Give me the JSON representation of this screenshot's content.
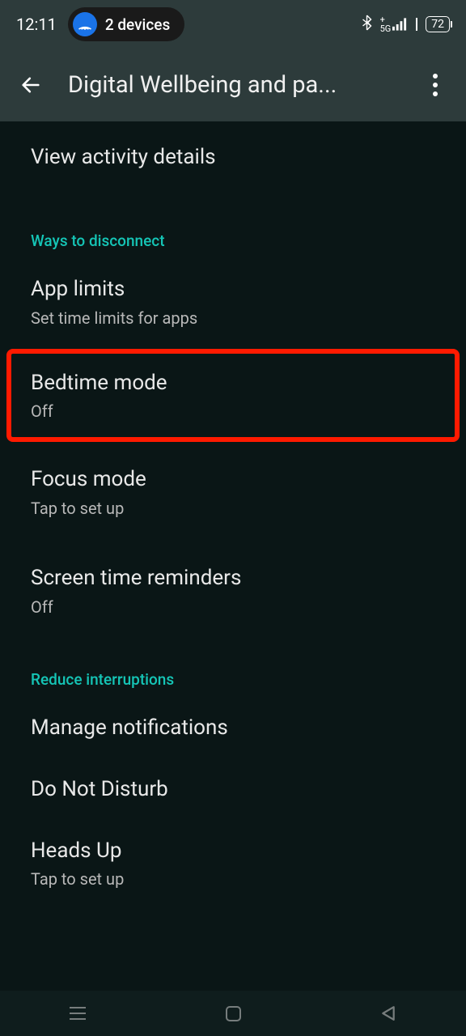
{
  "statusbar": {
    "time": "12:11",
    "devices_label": "2 devices",
    "signal_label": "5G",
    "battery": "72"
  },
  "header": {
    "title": "Digital Wellbeing and pa..."
  },
  "activity": {
    "view_details": "View activity details"
  },
  "sections": {
    "disconnect": "Ways to disconnect",
    "interruptions": "Reduce interruptions"
  },
  "items": {
    "app_limits": {
      "title": "App limits",
      "sub": "Set time limits for apps"
    },
    "bedtime": {
      "title": "Bedtime mode",
      "sub": "Off"
    },
    "focus": {
      "title": "Focus mode",
      "sub": "Tap to set up"
    },
    "screen_time": {
      "title": "Screen time reminders",
      "sub": "Off"
    },
    "manage_notifications": {
      "title": "Manage notifications"
    },
    "dnd": {
      "title": "Do Not Disturb"
    },
    "heads_up": {
      "title": "Heads Up",
      "sub": "Tap to set up"
    }
  }
}
